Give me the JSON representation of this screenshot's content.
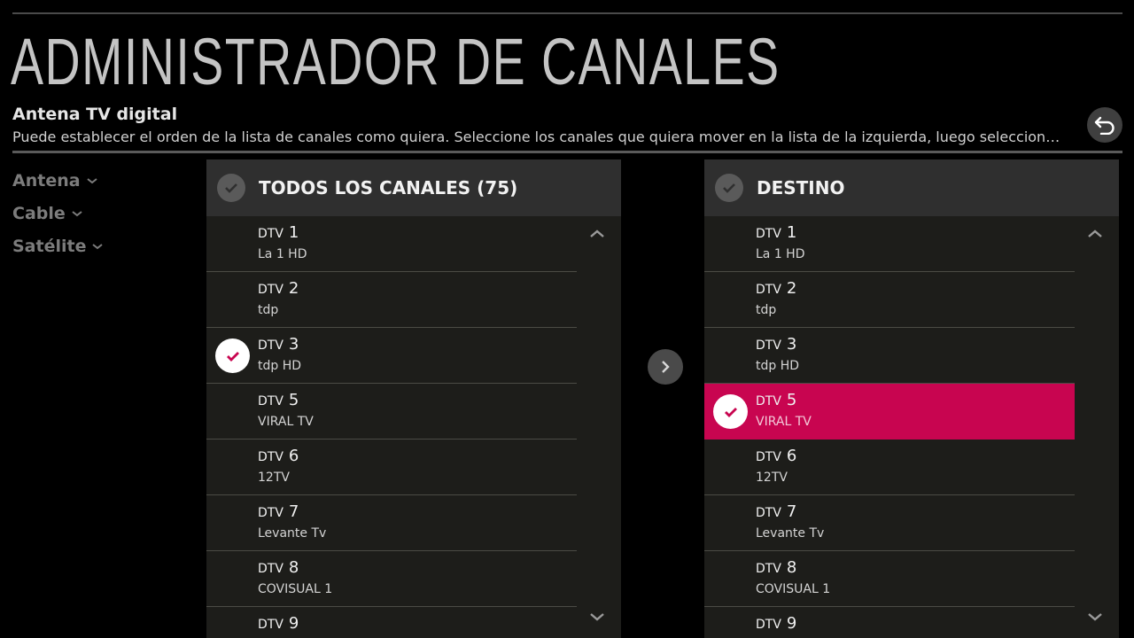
{
  "page": {
    "title": "ADMINISTRADOR DE CANALES",
    "subtitle": "Antena TV digital",
    "description": "Puede establecer el orden de la lista de canales como quiera. Seleccione los canales que quiera mover en la lista de la izquierda, luego seleccione un o..."
  },
  "icons": {
    "back": "back-arrow-icon",
    "move": "chevron-right-icon",
    "check": "checkmark-icon",
    "scroll_up": "chevron-up-icon",
    "scroll_down": "chevron-down-icon"
  },
  "colors": {
    "accent": "#c80550",
    "background": "#000000",
    "panel": "#1d1d1a",
    "panel_header": "#2f2f2f",
    "nav_text": "#7c7c7c"
  },
  "sidebar": {
    "items": [
      {
        "label": "Antena"
      },
      {
        "label": "Cable"
      },
      {
        "label": "Satélite"
      }
    ]
  },
  "left_panel": {
    "title": "TODOS LOS CANALES (75)",
    "channels": [
      {
        "type": "DTV",
        "number": "1",
        "name": "La 1 HD",
        "checked": false
      },
      {
        "type": "DTV",
        "number": "2",
        "name": "tdp",
        "checked": false
      },
      {
        "type": "DTV",
        "number": "3",
        "name": "tdp HD",
        "checked": true
      },
      {
        "type": "DTV",
        "number": "5",
        "name": "VIRAL TV",
        "checked": false
      },
      {
        "type": "DTV",
        "number": "6",
        "name": "12TV",
        "checked": false
      },
      {
        "type": "DTV",
        "number": "7",
        "name": "Levante Tv",
        "checked": false
      },
      {
        "type": "DTV",
        "number": "8",
        "name": "COVISUAL 1",
        "checked": false
      },
      {
        "type": "DTV",
        "number": "9",
        "name": "",
        "checked": false
      }
    ]
  },
  "right_panel": {
    "title": "DESTINO",
    "channels": [
      {
        "type": "DTV",
        "number": "1",
        "name": "La 1 HD",
        "checked": false
      },
      {
        "type": "DTV",
        "number": "2",
        "name": "tdp",
        "checked": false
      },
      {
        "type": "DTV",
        "number": "3",
        "name": "tdp HD",
        "checked": false
      },
      {
        "type": "DTV",
        "number": "5",
        "name": "VIRAL TV",
        "checked": true,
        "highlighted": true
      },
      {
        "type": "DTV",
        "number": "6",
        "name": "12TV",
        "checked": false
      },
      {
        "type": "DTV",
        "number": "7",
        "name": "Levante Tv",
        "checked": false
      },
      {
        "type": "DTV",
        "number": "8",
        "name": "COVISUAL 1",
        "checked": false
      },
      {
        "type": "DTV",
        "number": "9",
        "name": "",
        "checked": false
      }
    ]
  }
}
